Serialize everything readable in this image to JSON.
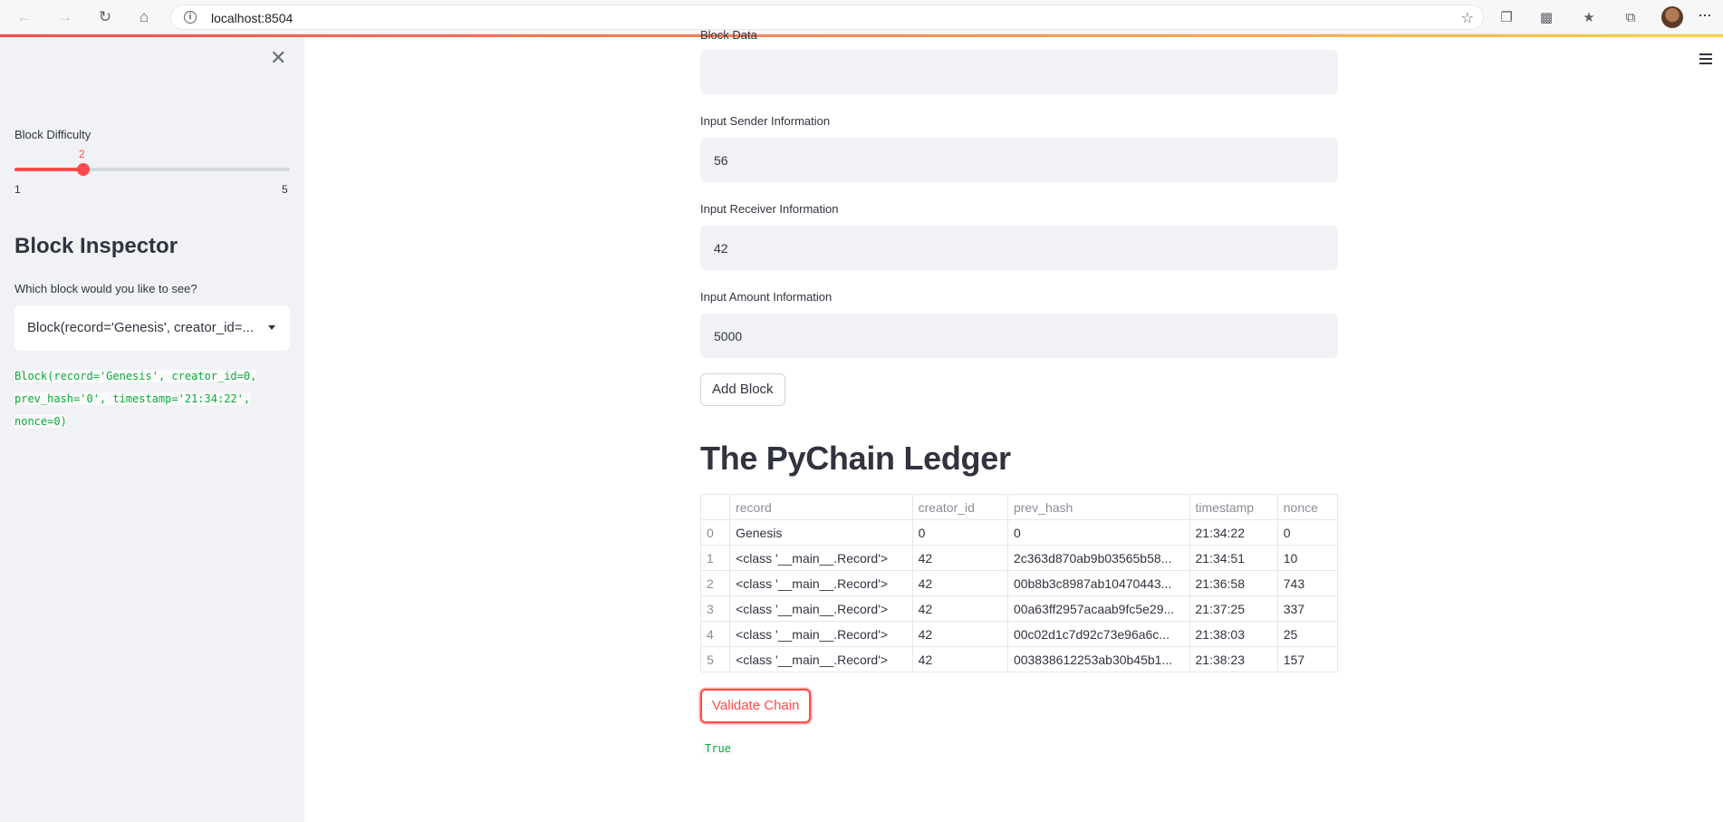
{
  "browser": {
    "url": "localhost:8504"
  },
  "sidebar": {
    "slider": {
      "label": "Block Difficulty",
      "value": 2,
      "value_text": "2",
      "min": 1,
      "max": 5,
      "min_text": "1",
      "max_text": "5",
      "accent_color": "#ff4b4b"
    },
    "inspector": {
      "heading": "Block Inspector",
      "prompt": "Which block would you like to see?",
      "selected": "Block(record='Genesis', creator_id=...",
      "output_lines": [
        "Block(record='Genesis', creator_id=0,",
        "prev_hash='0', timestamp='21:34:22',",
        "nonce=0)"
      ]
    }
  },
  "form": {
    "cut_label": "Block Data",
    "sender": {
      "label": "Input Sender Information",
      "value": "56"
    },
    "receiver": {
      "label": "Input Receiver Information",
      "value": "42"
    },
    "amount": {
      "label": "Input Amount Information",
      "value": "5000"
    },
    "add_button": "Add Block"
  },
  "ledger": {
    "title": "The PyChain Ledger",
    "columns": [
      "",
      "record",
      "creator_id",
      "prev_hash",
      "timestamp",
      "nonce"
    ],
    "rows": [
      [
        "0",
        "Genesis",
        "0",
        "0",
        "21:34:22",
        "0"
      ],
      [
        "1",
        "<class '__main__.Record'>",
        "42",
        "2c363d870ab9b03565b58...",
        "21:34:51",
        "10"
      ],
      [
        "2",
        "<class '__main__.Record'>",
        "42",
        "00b8b3c8987ab10470443...",
        "21:36:58",
        "743"
      ],
      [
        "3",
        "<class '__main__.Record'>",
        "42",
        "00a63ff2957acaab9fc5e29...",
        "21:37:25",
        "337"
      ],
      [
        "4",
        "<class '__main__.Record'>",
        "42",
        "00c02d1c7d92c73e96a6c...",
        "21:38:03",
        "25"
      ],
      [
        "5",
        "<class '__main__.Record'>",
        "42",
        "003838612253ab30b45b1...",
        "21:38:23",
        "157"
      ]
    ]
  },
  "validate": {
    "button": "Validate Chain",
    "result": "True"
  },
  "colors": {
    "primary": "#ff4b4b",
    "code_green": "#09ab3b",
    "sidebar_bg": "#f0f2f6"
  }
}
